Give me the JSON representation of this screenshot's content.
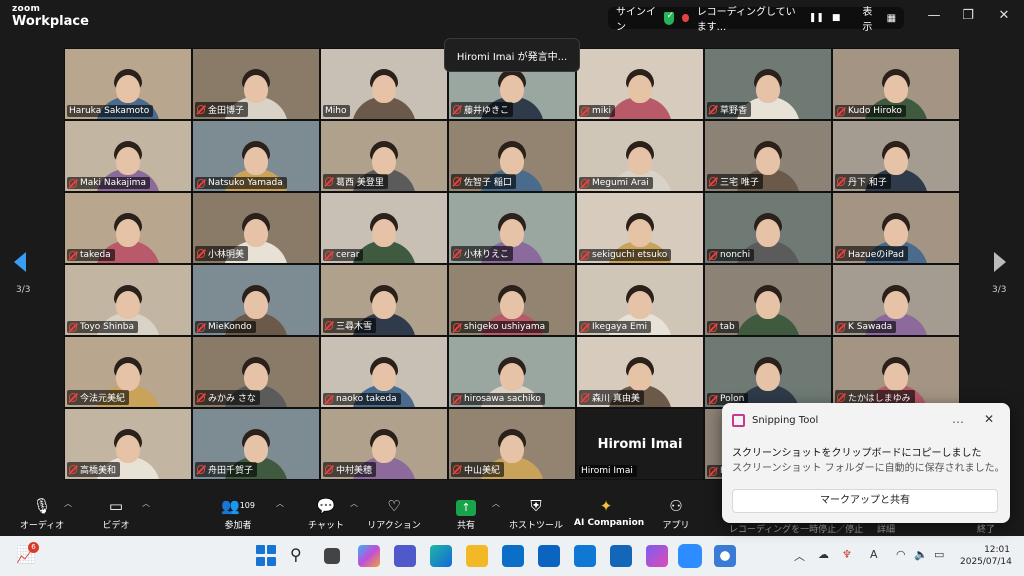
{
  "app": {
    "logo_top": "zoom",
    "logo_bottom": "Workplace"
  },
  "status": {
    "signin": "サインイン",
    "recording": "レコーディングしています...",
    "view": "表示"
  },
  "speaking": "Hiromi Imai が発言中...",
  "page_indicator": "3/3",
  "participants": [
    {
      "name": "Haruka Sakamoto",
      "muted": false
    },
    {
      "name": "金田博子",
      "muted": true
    },
    {
      "name": "Miho",
      "muted": false
    },
    {
      "name": "藤井ゆきこ",
      "muted": true
    },
    {
      "name": "miki",
      "muted": true
    },
    {
      "name": "草野香",
      "muted": true
    },
    {
      "name": "Kudo Hiroko",
      "muted": true
    },
    {
      "name": "Maki Nakajima",
      "muted": true
    },
    {
      "name": "Natsuko Yamada",
      "muted": true
    },
    {
      "name": "葛西 美登里",
      "muted": true
    },
    {
      "name": "佐智子 稲口",
      "muted": true
    },
    {
      "name": "Megumi  Arai",
      "muted": true
    },
    {
      "name": "三宅 唯子",
      "muted": true
    },
    {
      "name": "丹下 和子",
      "muted": true
    },
    {
      "name": "takeda",
      "muted": true
    },
    {
      "name": "小林明美",
      "muted": true
    },
    {
      "name": "cerar",
      "muted": true
    },
    {
      "name": "小林りえこ",
      "muted": true
    },
    {
      "name": "sekiguchi etsuko",
      "muted": true
    },
    {
      "name": "nonchi",
      "muted": true
    },
    {
      "name": "HazueのiPad",
      "muted": true
    },
    {
      "name": "Toyo Shinba",
      "muted": true
    },
    {
      "name": "MieKondo",
      "muted": true
    },
    {
      "name": "三尋木雪",
      "muted": true
    },
    {
      "name": "shigeko ushiyama",
      "muted": true
    },
    {
      "name": "Ikegaya Emi",
      "muted": true
    },
    {
      "name": "tab",
      "muted": true
    },
    {
      "name": "K Sawada",
      "muted": true
    },
    {
      "name": "今法元美紀",
      "muted": true
    },
    {
      "name": "みかみ さな",
      "muted": true
    },
    {
      "name": "naoko takeda",
      "muted": true
    },
    {
      "name": "hirosawa sachiko",
      "muted": true
    },
    {
      "name": "森川 真由美",
      "muted": true
    },
    {
      "name": "Polon",
      "muted": true
    },
    {
      "name": "たかはしまゆみ",
      "muted": true
    },
    {
      "name": "高橋美和",
      "muted": true
    },
    {
      "name": "舟田千賀子",
      "muted": true
    },
    {
      "name": "中村美穂",
      "muted": true
    },
    {
      "name": "中山美紀",
      "muted": true
    },
    {
      "name": "Hiromi Imai",
      "muted": false,
      "video_off": true,
      "display": "Hiromi Imai"
    },
    {
      "name": "Hi",
      "muted": true
    },
    {
      "name": "",
      "muted": false
    }
  ],
  "toolbar": {
    "audio": "オーディオ",
    "video": "ビデオ",
    "participants": "参加者",
    "participants_count": "109",
    "chat": "チャット",
    "reactions": "リアクション",
    "share": "共有",
    "host_tools": "ホストツール",
    "ai_companion": "AI Companion",
    "apps": "アプリ",
    "recording_ctl": "レコーディングを一時停止／停止",
    "details": "詳細",
    "end": "終了"
  },
  "toast": {
    "app": "Snipping Tool",
    "headline": "スクリーンショットをクリップボードにコピーしました",
    "body": "スクリーンショット フォルダーに自動的に保存されました。",
    "button": "マークアップと共有",
    "more": "…",
    "close": "✕"
  },
  "taskbar": {
    "time": "12:01",
    "date": "2025/07/14",
    "notification_count": "6",
    "ime": "A"
  },
  "colors": {
    "accent_blue": "#3a9cf3",
    "share_green": "#19a34a",
    "mute_red": "#e0443e"
  }
}
